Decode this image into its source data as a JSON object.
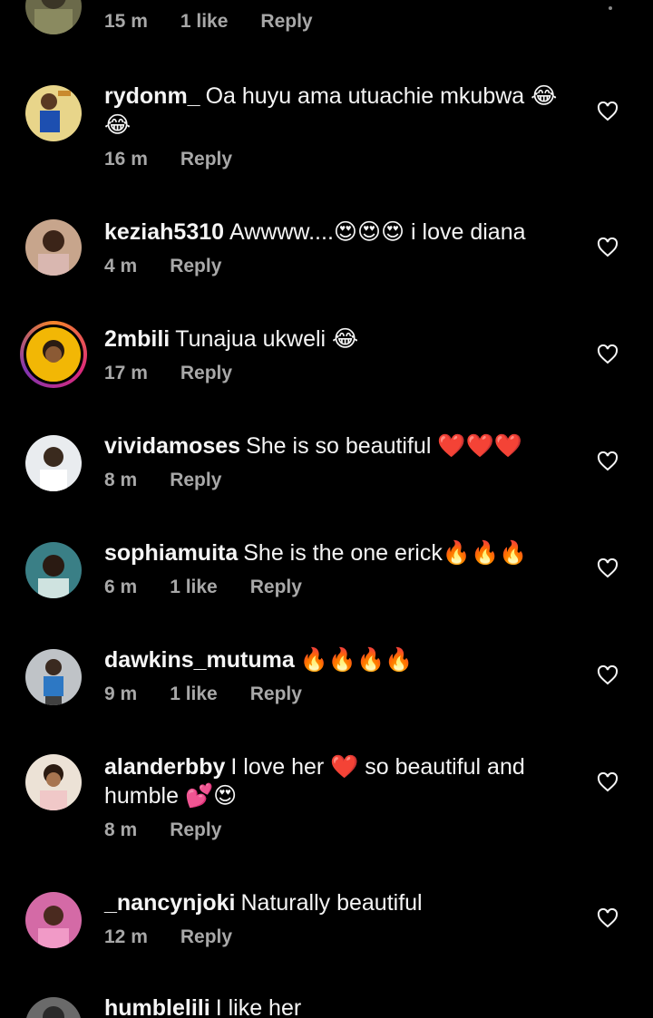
{
  "comments": [
    {
      "user": "",
      "text": "",
      "time": "15 m",
      "likes": "1 like",
      "reply": "Reply",
      "avatar": "partial-top-avatar"
    },
    {
      "user": "rydonm_",
      "text": "Oa huyu ama utuachie mkubwa 😂😂",
      "time": "16 m",
      "likes": "",
      "reply": "Reply",
      "avatar": "basketball-player-avatar"
    },
    {
      "user": "keziah5310",
      "text": "Awwww....😍😍😍 i love diana",
      "time": "4 m",
      "likes": "",
      "reply": "Reply",
      "avatar": "woman-avatar"
    },
    {
      "user": "2mbili",
      "text": "Tunajua ukweli 😂",
      "time": "17 m",
      "likes": "",
      "reply": "Reply",
      "avatar": "cartoon-face-avatar"
    },
    {
      "user": "vividamoses",
      "text": "She is so beautiful ❤️❤️❤️",
      "time": "8 m",
      "likes": "",
      "reply": "Reply",
      "avatar": "woman-avatar"
    },
    {
      "user": "sophiamuita",
      "text": "She is the one erick🔥🔥🔥",
      "time": "6 m",
      "likes": "1 like",
      "reply": "Reply",
      "avatar": "woman-avatar"
    },
    {
      "user": "dawkins_mutuma",
      "text": "🔥🔥🔥🔥",
      "time": "9 m",
      "likes": "1 like",
      "reply": "Reply",
      "avatar": "man-avatar"
    },
    {
      "user": "alanderbby",
      "text": "I love her ❤️ so beautiful and humble 💕😍",
      "time": "8 m",
      "likes": "",
      "reply": "Reply",
      "avatar": "woman-avatar"
    },
    {
      "user": "_nancynjoki",
      "text": "Naturally beautiful",
      "time": "12 m",
      "likes": "",
      "reply": "Reply",
      "avatar": "woman-avatar"
    },
    {
      "user": "humblelili",
      "text": "I like her",
      "time": "",
      "likes": "",
      "reply": "",
      "avatar": "partial-bottom-avatar"
    }
  ],
  "colors": {
    "background": "#000000",
    "text": "#f5f5f5",
    "meta": "#a8a8a8",
    "heart": "#f5f5f5"
  }
}
